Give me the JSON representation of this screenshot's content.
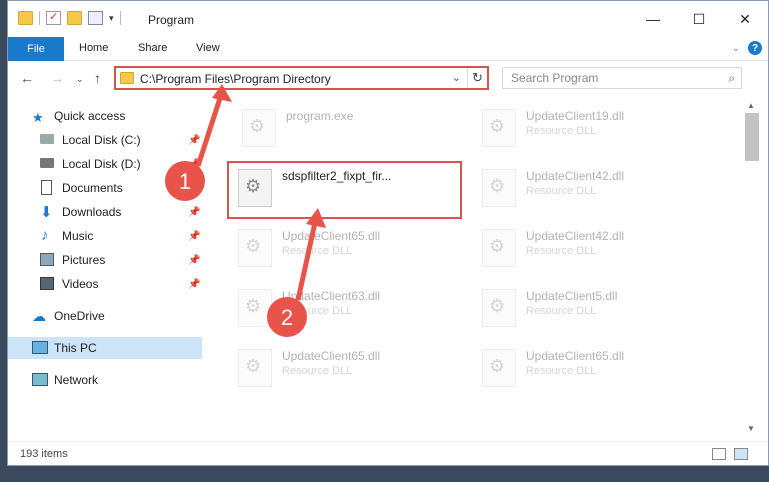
{
  "window": {
    "title": "Program",
    "controls": [
      "—",
      "☐",
      "✕"
    ]
  },
  "ribbon": {
    "tabs": [
      "File",
      "Home",
      "Share",
      "View"
    ],
    "help": "?"
  },
  "address": {
    "path": "C:\\Program Files\\Program Directory",
    "refresh": "↻"
  },
  "search": {
    "placeholder": "Search Program",
    "icon": "⌕"
  },
  "sidebar": {
    "items": [
      {
        "label": "Quick access",
        "icon": "star-icon"
      },
      {
        "label": "Local Disk (C:)",
        "icon": "drive-icon",
        "pinned": true
      },
      {
        "label": "Local Disk (D:)",
        "icon": "drive-icon",
        "pinned": true
      },
      {
        "label": "Documents",
        "icon": "documents-icon",
        "pinned": true
      },
      {
        "label": "Downloads",
        "icon": "downloads-icon",
        "pinned": true
      },
      {
        "label": "Music",
        "icon": "music-icon",
        "pinned": true
      },
      {
        "label": "Pictures",
        "icon": "pictures-icon",
        "pinned": true
      },
      {
        "label": "Videos",
        "icon": "videos-icon",
        "pinned": true
      },
      {
        "label": "OneDrive",
        "icon": "cloud-icon"
      },
      {
        "label": "This PC",
        "icon": "computer-icon",
        "selected": true
      },
      {
        "label": "Network",
        "icon": "network-icon"
      }
    ]
  },
  "files": [
    {
      "name": "program.exe",
      "type": "",
      "faded": true
    },
    {
      "name": "UpdateClient19.dll",
      "type": "Resource DLL",
      "faded": true
    },
    {
      "name": "sdspfilter2_fixpt_fir...",
      "type": "",
      "faded": false
    },
    {
      "name": "UpdateClient42.dll",
      "type": "Resource DLL",
      "faded": true
    },
    {
      "name": "UpdateClient65.dll",
      "type": "Resource DLL",
      "faded": true
    },
    {
      "name": "UpdateClient42.dll",
      "type": "Resource DLL",
      "faded": true
    },
    {
      "name": "UpdateClient63.dll",
      "type": "Resource DLL",
      "faded": true
    },
    {
      "name": "UpdateClient5.dll",
      "type": "Resource DLL",
      "faded": true
    },
    {
      "name": "UpdateClient65.dll",
      "type": "Resource DLL",
      "faded": true
    },
    {
      "name": "UpdateClient65.dll",
      "type": "Resource DLL",
      "faded": true
    }
  ],
  "annotations": {
    "step1": "1",
    "step2": "2",
    "color": "#e8534a"
  },
  "status": {
    "count": "193 items"
  }
}
